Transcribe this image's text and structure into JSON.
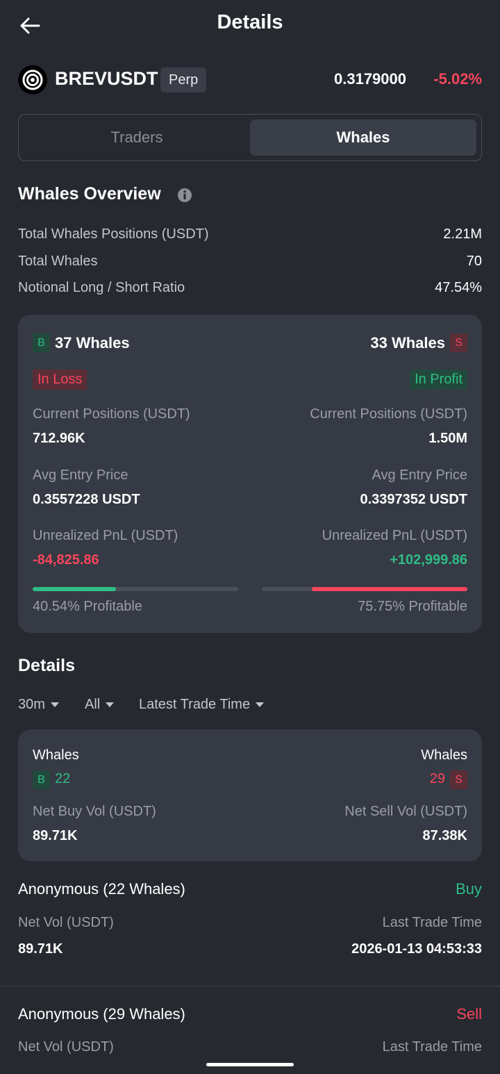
{
  "header": {
    "title": "Details",
    "back_icon": "back-arrow-icon"
  },
  "ticker": {
    "symbol": "BREVUSDT",
    "badge": "Perp",
    "price": "0.3179000",
    "change": "-5.02%",
    "logo_icon": "coin-logo-icon"
  },
  "tabs": [
    {
      "label": "Traders",
      "active": false
    },
    {
      "label": "Whales",
      "active": true
    }
  ],
  "overview": {
    "title": "Whales Overview",
    "rows": [
      {
        "label": "Total Whales Positions (USDT)",
        "value": "2.21M"
      },
      {
        "label": "Total Whales",
        "value": "70"
      },
      {
        "label": "Notional Long / Short Ratio",
        "value": "47.54%"
      }
    ],
    "long": {
      "tag": "B",
      "count": "37 Whales",
      "status": "In Loss",
      "positions_label": "Current Positions (USDT)",
      "positions": "712.96K",
      "entry_label": "Avg Entry Price",
      "entry": "0.3557228 USDT",
      "pnl_label": "Unrealized PnL (USDT)",
      "pnl": "-84,825.86",
      "profitable_text": "40.54% Profitable",
      "profitable_fraction": 0.4054
    },
    "short": {
      "tag": "S",
      "count": "33 Whales",
      "status": "In Profit",
      "positions_label": "Current Positions (USDT)",
      "positions": "1.50M",
      "entry_label": "Avg Entry Price",
      "entry": "0.3397352 USDT",
      "pnl_label": "Unrealized PnL (USDT)",
      "pnl": "+102,999.86",
      "profitable_text": "75.75% Profitable",
      "profitable_fraction": 0.7575
    }
  },
  "details": {
    "title": "Details",
    "filters": [
      "30m",
      "All",
      "Latest Trade Time"
    ],
    "summary": {
      "buy_label": "Whales",
      "buy_tag": "B",
      "buy_count": "22",
      "sell_label": "Whales",
      "sell_tag": "S",
      "sell_count": "29",
      "buy_vol_label": "Net Buy Vol (USDT)",
      "buy_vol": "89.71K",
      "sell_vol_label": "Net Sell Vol (USDT)",
      "sell_vol": "87.38K"
    },
    "entries": [
      {
        "name": "Anonymous (22 Whales)",
        "side": "Buy",
        "vol_label": "Net Vol (USDT)",
        "vol": "89.71K",
        "time_label": "Last Trade Time",
        "time": "2026-01-13 04:53:33"
      },
      {
        "name": "Anonymous (29 Whales)",
        "side": "Sell",
        "vol_label": "Net Vol (USDT)",
        "time_label": "Last Trade Time"
      }
    ]
  },
  "colors": {
    "background": "#262930",
    "card": "#363a44",
    "green": "#2ebd85",
    "red": "#f6465d"
  }
}
